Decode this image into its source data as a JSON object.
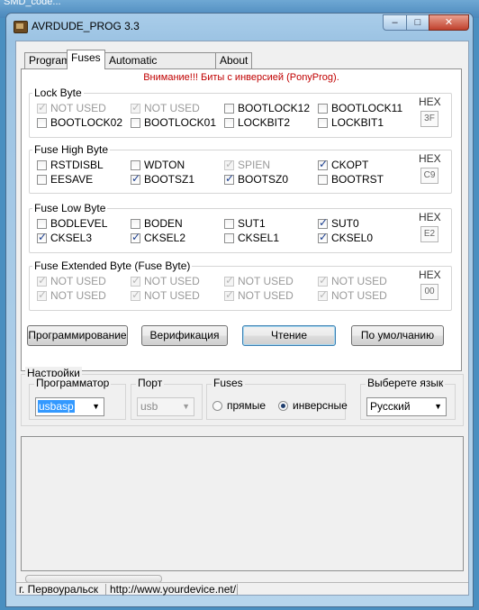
{
  "desktop": {
    "top_text": "SMD_code..."
  },
  "window": {
    "title": "AVRDUDE_PROG 3.3",
    "min": "–",
    "max": "□",
    "close": "✕"
  },
  "tabs": [
    "Program",
    "Fuses",
    "Automatic programming",
    "About"
  ],
  "active_tab": "Fuses",
  "warning": "Внимание!!! Биты с инверсией (PonyProg).",
  "hex_label": "HEX",
  "groups": {
    "lock": {
      "title": "Lock Byte",
      "hex": "3F",
      "bits": [
        {
          "label": "NOT USED",
          "checked": true,
          "disabled": true
        },
        {
          "label": "NOT USED",
          "checked": true,
          "disabled": true
        },
        {
          "label": "BOOTLOCK12",
          "checked": false,
          "disabled": false
        },
        {
          "label": "BOOTLOCK11",
          "checked": false,
          "disabled": false
        },
        {
          "label": "BOOTLOCK02",
          "checked": false,
          "disabled": false
        },
        {
          "label": "BOOTLOCK01",
          "checked": false,
          "disabled": false
        },
        {
          "label": "LOCKBIT2",
          "checked": false,
          "disabled": false
        },
        {
          "label": "LOCKBIT1",
          "checked": false,
          "disabled": false
        }
      ]
    },
    "high": {
      "title": "Fuse High Byte",
      "hex": "C9",
      "bits": [
        {
          "label": "RSTDISBL",
          "checked": false,
          "disabled": false
        },
        {
          "label": "WDTON",
          "checked": false,
          "disabled": false
        },
        {
          "label": "SPIEN",
          "checked": true,
          "disabled": true
        },
        {
          "label": "CKOPT",
          "checked": true,
          "disabled": false
        },
        {
          "label": "EESAVE",
          "checked": false,
          "disabled": false
        },
        {
          "label": "BOOTSZ1",
          "checked": true,
          "disabled": false
        },
        {
          "label": "BOOTSZ0",
          "checked": true,
          "disabled": false
        },
        {
          "label": "BOOTRST",
          "checked": false,
          "disabled": false
        }
      ]
    },
    "low": {
      "title": "Fuse Low Byte",
      "hex": "E2",
      "bits": [
        {
          "label": "BODLEVEL",
          "checked": false,
          "disabled": false
        },
        {
          "label": "BODEN",
          "checked": false,
          "disabled": false
        },
        {
          "label": "SUT1",
          "checked": false,
          "disabled": false
        },
        {
          "label": "SUT0",
          "checked": true,
          "disabled": false
        },
        {
          "label": "CKSEL3",
          "checked": true,
          "disabled": false
        },
        {
          "label": "CKSEL2",
          "checked": true,
          "disabled": false
        },
        {
          "label": "CKSEL1",
          "checked": false,
          "disabled": false
        },
        {
          "label": "CKSEL0",
          "checked": true,
          "disabled": false
        }
      ]
    },
    "ext": {
      "title": "Fuse Extended Byte (Fuse Byte)",
      "hex": "00",
      "bits": [
        {
          "label": "NOT USED",
          "checked": true,
          "disabled": true
        },
        {
          "label": "NOT USED",
          "checked": true,
          "disabled": true
        },
        {
          "label": "NOT USED",
          "checked": true,
          "disabled": true
        },
        {
          "label": "NOT USED",
          "checked": true,
          "disabled": true
        },
        {
          "label": "NOT USED",
          "checked": true,
          "disabled": true
        },
        {
          "label": "NOT USED",
          "checked": true,
          "disabled": true
        },
        {
          "label": "NOT USED",
          "checked": true,
          "disabled": true
        },
        {
          "label": "NOT USED",
          "checked": true,
          "disabled": true
        }
      ]
    }
  },
  "buttons": {
    "program": "Программирование",
    "verify": "Верификация",
    "read": "Чтение",
    "default": "По умолчанию"
  },
  "settings": {
    "title": "Настройки",
    "programmer": {
      "label": "Программатор",
      "value": "usbasp"
    },
    "port": {
      "label": "Порт",
      "value": "usb"
    },
    "fuses": {
      "label": "Fuses",
      "option_direct": "прямые",
      "option_inverse": "инверсные",
      "selected": "инверсные"
    },
    "language": {
      "label": "Выберете язык",
      "value": "Русский"
    }
  },
  "status": {
    "city": "г. Первоуральск",
    "url": "http://www.yourdevice.net/"
  }
}
